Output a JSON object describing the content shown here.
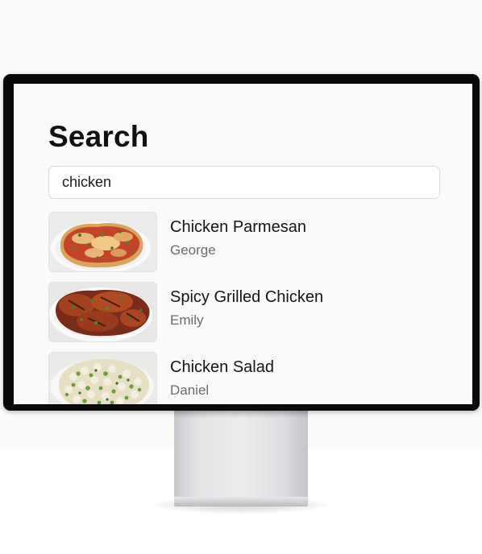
{
  "page": {
    "title": "Search"
  },
  "search": {
    "value": "chicken",
    "placeholder": ""
  },
  "results": [
    {
      "title": "Chicken Parmesan",
      "author": "George",
      "image": "chicken-parmesan-photo"
    },
    {
      "title": "Spicy Grilled Chicken",
      "author": "Emily",
      "image": "grilled-chicken-photo"
    },
    {
      "title": "Chicken Salad",
      "author": "Daniel",
      "image": "chicken-salad-photo"
    }
  ],
  "colors": {
    "screen_background": "#fafaf9",
    "bezel": "#0a0a0a",
    "title_text": "#111111",
    "secondary_text": "#6b6b6b",
    "input_border": "#dcdcdc"
  }
}
